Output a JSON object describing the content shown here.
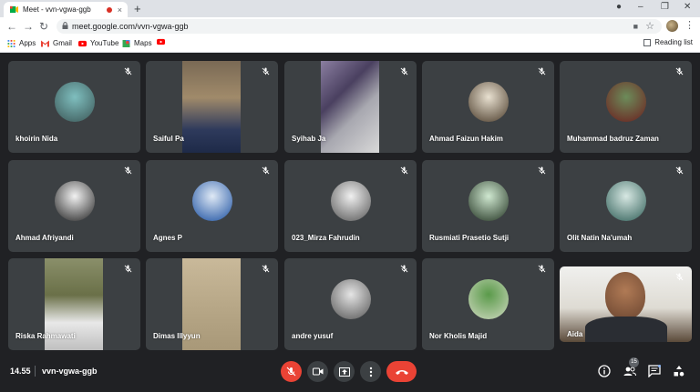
{
  "browser": {
    "tab_title": "Meet - vvn-vgwa-ggb",
    "tab_close": "×",
    "new_tab": "+",
    "url": "meet.google.com/vvn-vgwa-ggb",
    "bookmarks": [
      {
        "label": "Apps",
        "icon": "apps-grid-icon"
      },
      {
        "label": "Gmail",
        "icon": "gmail-icon"
      },
      {
        "label": "YouTube",
        "icon": "youtube-icon"
      },
      {
        "label": "Maps",
        "icon": "maps-icon"
      },
      {
        "label": "",
        "icon": "youtube-icon"
      }
    ],
    "reading_list": "Reading list"
  },
  "participants": [
    {
      "name": "khoirin Nida",
      "type": "avatar",
      "colors": [
        "#7fbfbf",
        "#3b5656"
      ]
    },
    {
      "name": "Saiful Pa",
      "type": "video"
    },
    {
      "name": "Syihab Ja",
      "type": "video"
    },
    {
      "name": "Ahmad Faizun Hakim",
      "type": "avatar",
      "colors": [
        "#e8e0d0",
        "#4a3b2a"
      ]
    },
    {
      "name": "Muhammad badruz Zaman",
      "type": "avatar",
      "colors": [
        "#6c8c5a",
        "#6b1e1e"
      ]
    },
    {
      "name": "Ahmad Afriyandi",
      "type": "avatar",
      "colors": [
        "#f2f2f2",
        "#222222"
      ]
    },
    {
      "name": "Agnes P",
      "type": "avatar",
      "colors": [
        "#dfe9f5",
        "#1a4fa0"
      ]
    },
    {
      "name": "023_Mirza Fahrudin",
      "type": "avatar",
      "colors": [
        "#f0f0f0",
        "#555555"
      ]
    },
    {
      "name": "Rusmiati Prasetio Sutji",
      "type": "avatar",
      "colors": [
        "#cfe8d0",
        "#223322"
      ]
    },
    {
      "name": "Olit Natin Na'umah",
      "type": "avatar",
      "colors": [
        "#d7e8e3",
        "#2f5e57"
      ]
    },
    {
      "name": "Riska Rahmawati",
      "type": "video"
    },
    {
      "name": "Dimas Illyyun",
      "type": "video"
    },
    {
      "name": "andre yusuf",
      "type": "avatar",
      "colors": [
        "#e5e5e5",
        "#555555"
      ]
    },
    {
      "name": "Nor Kholis Majid",
      "type": "avatar",
      "colors": [
        "#5a9a4a",
        "#cfd9c0"
      ]
    },
    {
      "name": "Aida",
      "type": "video"
    }
  ],
  "meeting": {
    "time": "14.55",
    "code": "vvn-vgwa-ggb",
    "participant_count": "15"
  },
  "colors": {
    "background": "#202124",
    "tile": "#3c4043",
    "danger": "#ea4335"
  }
}
